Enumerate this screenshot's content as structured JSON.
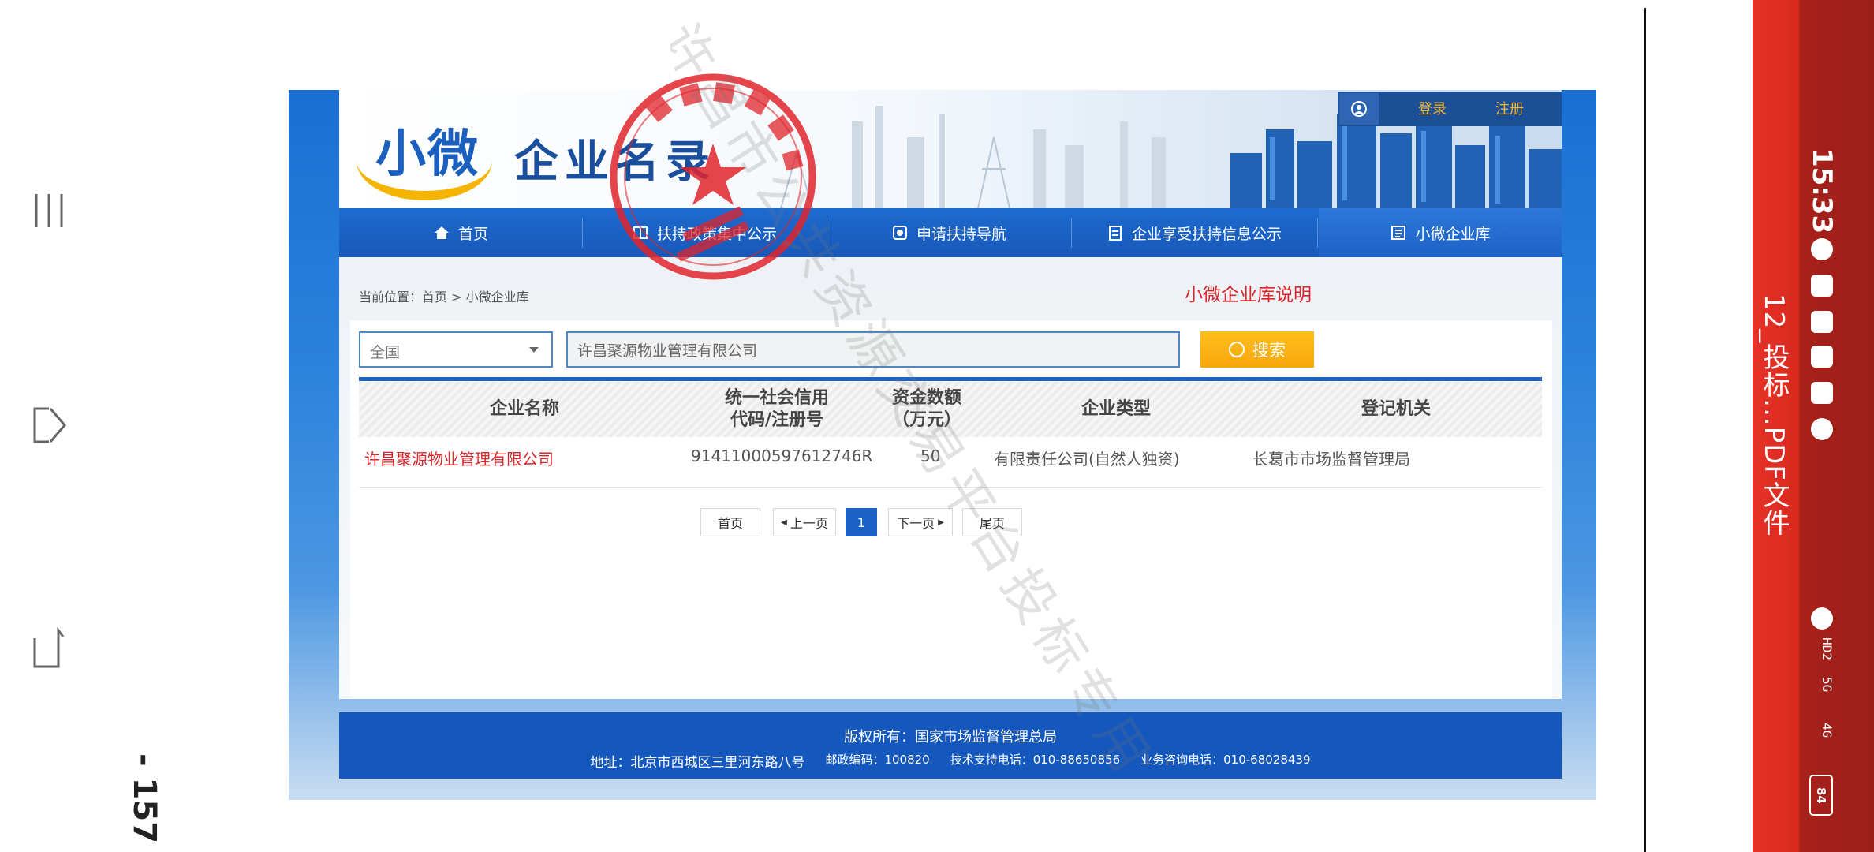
{
  "reader": {
    "page_number": "- 157 -",
    "file_title": "12_投标...PDF文件",
    "clock": "15:33",
    "network": [
      "HD2",
      "5G",
      "4G"
    ],
    "battery": "84"
  },
  "site": {
    "logo_small": "小微",
    "logo_text": "企业名录",
    "login": "登录",
    "register": "注册"
  },
  "nav": [
    {
      "label": "首页",
      "icon": "home-icon"
    },
    {
      "label": "扶持政策集中公示",
      "icon": "book-icon"
    },
    {
      "label": "申请扶持导航",
      "icon": "compass-icon"
    },
    {
      "label": "企业享受扶持信息公示",
      "icon": "clipboard-icon"
    },
    {
      "label": "小微企业库",
      "icon": "list-icon"
    }
  ],
  "breadcrumb": "当前位置：首页 > 小微企业库",
  "description_link": "小微企业库说明",
  "search": {
    "region": "全国",
    "query": "许昌聚源物业管理有限公司",
    "button": "搜索"
  },
  "table": {
    "headers": [
      "企业名称",
      "统一社会信用\n代码/注册号",
      "资金数额\n（万元）",
      "企业类型",
      "登记机关"
    ],
    "rows": [
      [
        "许昌聚源物业管理有限公司",
        "91411000597612746R",
        "50",
        "有限责任公司(自然人独资)",
        "长葛市市场监督管理局"
      ]
    ]
  },
  "pagination": {
    "first": "首页",
    "prev": "上一页",
    "current": "1",
    "next": "下一页",
    "last": "尾页"
  },
  "footer": {
    "copyright": "版权所有：国家市场监督管理总局",
    "address": "地址：北京市西城区三里河东路八号",
    "postcode": "邮政编码：100820",
    "tech": "技术支持电话：010-88650856",
    "consult": "业务咨询电话：010-68028439"
  },
  "stamp": {
    "name": "许昌聚源物业管理有限公司",
    "color": "#e0242b"
  },
  "watermark": "许昌市公共资源交易平台投标专用",
  "colors": {
    "primary": "#1a63c4",
    "accent": "#d8262a",
    "search_button": "#f7a70c",
    "status_bar": "#d8291f"
  }
}
